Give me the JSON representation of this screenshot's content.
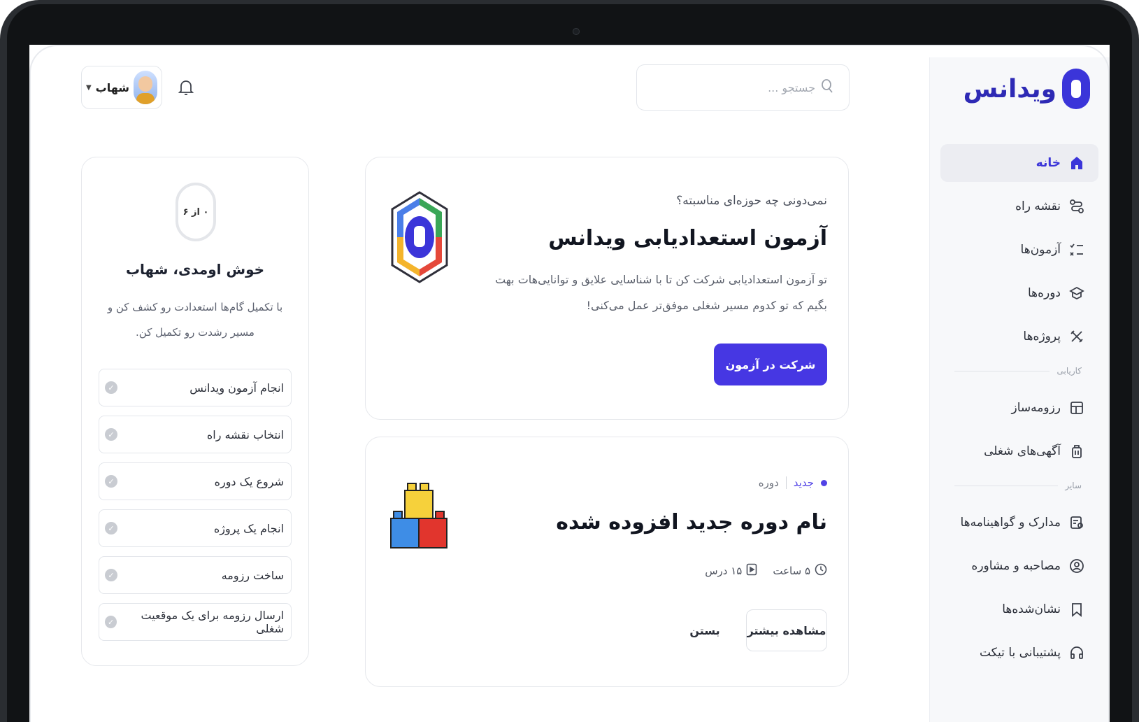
{
  "brand": {
    "name": "ویدانس"
  },
  "search": {
    "placeholder": "جستجو ..."
  },
  "user": {
    "name": "شهاب"
  },
  "nav": {
    "items": [
      {
        "label": "خانه",
        "icon": "home-icon",
        "active": true
      },
      {
        "label": "نقشه راه",
        "icon": "route-icon"
      },
      {
        "label": "آزمون‌ها",
        "icon": "checklist-icon"
      },
      {
        "label": "دوره‌ها",
        "icon": "graduation-cap-icon"
      },
      {
        "label": "پروژه‌ها",
        "icon": "tools-icon"
      }
    ],
    "section_career": "کاریابی",
    "career_items": [
      {
        "label": "رزومه‌ساز",
        "icon": "resume-icon"
      },
      {
        "label": "آگهی‌های شغلی",
        "icon": "briefcase-icon"
      }
    ],
    "section_other": "سایر",
    "other_items": [
      {
        "label": "مدارک و گواهینامه‌ها",
        "icon": "certificate-icon"
      },
      {
        "label": "مصاحبه و مشاوره",
        "icon": "consult-icon"
      },
      {
        "label": "نشان‌شده‌ها",
        "icon": "bookmark-icon"
      },
      {
        "label": "پشتیبانی با تیکت",
        "icon": "headset-icon"
      }
    ]
  },
  "progress": {
    "ring_label": "۰ از ۶",
    "welcome": "خوش اومدی، شهاب",
    "subtitle": "با تکمیل گام‌ها استعدادت رو کشف کن و مسیر رشدت رو تکمیل کن.",
    "steps": [
      "انجام آزمون ویدانس",
      "انتخاب نقشه راه",
      "شروع یک دوره",
      "انجام یک پروژه",
      "ساخت رزومه",
      "ارسال رزومه برای یک موقعیت شغلی"
    ]
  },
  "exam_card": {
    "subtitle": "نمی‌دونی چه حوزه‌ای مناسبته؟",
    "title": "آزمون استعدادیابی ویدانس",
    "description": "تو آزمون استعدادیابی شرکت کن تا با شناسایی علایق و توانایی‌هات بهت بگیم که تو کدوم مسیر شغلی موفق‌تر عمل می‌کنی!",
    "button": "شرکت در آزمون"
  },
  "course_card": {
    "badge": "جدید",
    "type": "دوره",
    "title": "نام دوره جدید افزوده شده",
    "duration": "۵ ساعت",
    "lessons": "۱۵ درس",
    "more_button": "مشاهده بیشتر",
    "close_button": "بستن"
  },
  "colors": {
    "accent": "#4637e3",
    "brand": "#2e2ab5"
  }
}
